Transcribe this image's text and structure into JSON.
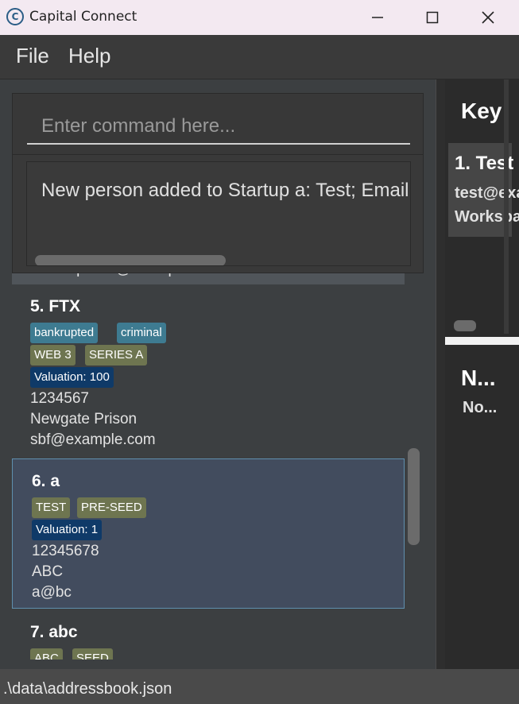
{
  "window": {
    "title": "Capital Connect",
    "icon": "app-logo-icon"
  },
  "menu": {
    "file": "File",
    "help": "Help"
  },
  "command": {
    "placeholder": "Enter command here...",
    "value": ""
  },
  "result": {
    "text": "New person added to Startup a: Test; Email: test@example.com; Workspace"
  },
  "startups": [
    {
      "partial_email": "sundarpichai@example.com"
    },
    {
      "index_title": "5.  FTX",
      "tags_blue": [
        "bankrupted",
        "criminal"
      ],
      "tags_olive": [
        "WEB 3",
        "SERIES A"
      ],
      "valuation": "Valuation: 100",
      "phone": "1234567",
      "address": "Newgate Prison",
      "email": "sbf@example.com"
    },
    {
      "index_title": "6.  a",
      "tags_olive": [
        "TEST",
        "PRE-SEED"
      ],
      "valuation": "Valuation: 1",
      "phone": "12345678",
      "address": "ABC",
      "email": "a@bc",
      "selected": true
    },
    {
      "index_title": "7.  abc",
      "tags_olive": [
        "ABC",
        "SEED"
      ]
    }
  ],
  "key_panel": {
    "header": "Key",
    "person_title": "1. Test",
    "person_email": "test@example.com",
    "person_workspace": "Workspace",
    "notes_header": "N...",
    "notes_text": "No..."
  },
  "status": {
    "path": ".\\data\\addressbook.json"
  },
  "colors": {
    "tag_blue": "#3e7b91",
    "tag_olive": "#6e7550",
    "valuation": "#0f3a68",
    "selected_card": "#424c5e"
  }
}
